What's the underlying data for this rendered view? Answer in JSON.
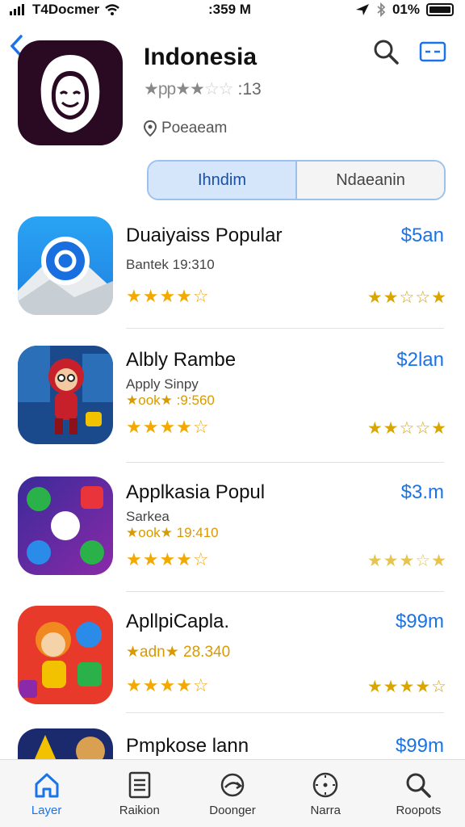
{
  "status": {
    "carrier": "T4Docmer",
    "time": ":359 M",
    "battery": "01%"
  },
  "header": {
    "back_icon": "chevron-left-icon",
    "title": "Indonesia",
    "rating_prefix": "pp",
    "rating_text": ":13",
    "location": "Poeaeam",
    "search_icon": "search-icon",
    "card_icon": "card-icon"
  },
  "segment": {
    "active_label": "Ihndim",
    "inactive_label": "Ndaeanin"
  },
  "apps": [
    {
      "title": "Duaiyaiss Popular",
      "subtitle": "Bantek 19:310",
      "price": "$5an",
      "stars_left": "★★★★☆",
      "stars_right": "★★☆☆★"
    },
    {
      "title": "Albly Rambe",
      "subtitle": "Apply Sinpy",
      "meta": "★ook★ :9:560",
      "price": "$2lan",
      "stars_left": "★★★★☆",
      "stars_right": "★★☆☆★"
    },
    {
      "title": "Applkasia Popul",
      "subtitle": "Sarkea",
      "meta": "★ook★ 19:410",
      "price": "$3.m",
      "stars_left": "★★★★☆",
      "stars_right": "★★★☆★"
    },
    {
      "title": "ApllpiCapla.",
      "meta": "★adn★ 28.340",
      "price": "$99m",
      "stars_left": "★★★★☆",
      "stars_right": "★★★★☆"
    },
    {
      "title": "Pmpkose lann",
      "price": "$99m"
    }
  ],
  "tabs": [
    {
      "label": "Layer",
      "icon": "home-icon"
    },
    {
      "label": "Raikion",
      "icon": "document-icon"
    },
    {
      "label": "Doonger",
      "icon": "refresh-icon"
    },
    {
      "label": "Narra",
      "icon": "compass-icon"
    },
    {
      "label": "Roopots",
      "icon": "search-icon"
    }
  ],
  "colors": {
    "accent": "#1a73e8",
    "star": "#f2a900"
  }
}
